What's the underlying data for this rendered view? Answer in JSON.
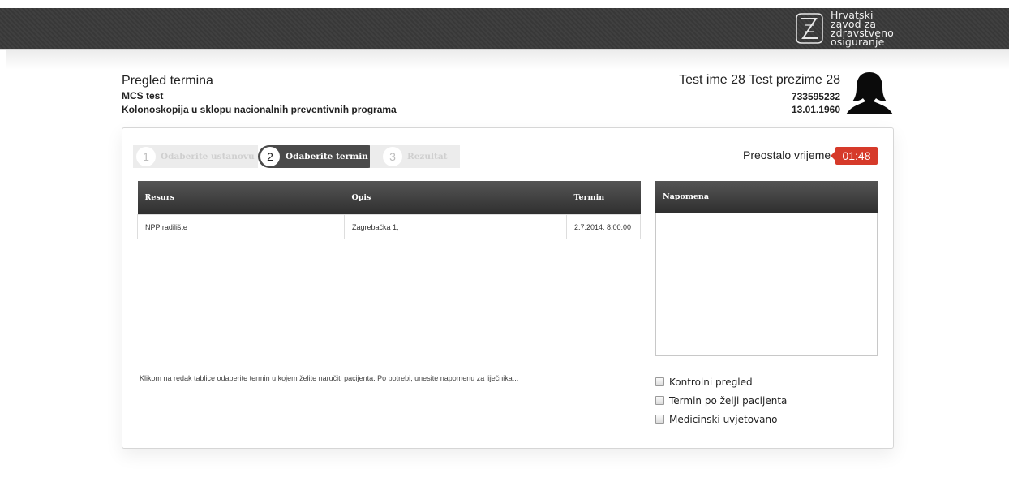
{
  "header": {
    "logo_lines": [
      "Hrvatski",
      "zavod za",
      "zdravstveno",
      "osiguranje"
    ]
  },
  "page": {
    "title": "Pregled termina",
    "subtitle_1": "MCS test",
    "subtitle_2": "Kolonoskopija u sklopu nacionalnih preventivnih programa"
  },
  "patient": {
    "name": "Test ime 28 Test prezime 28",
    "id": "733595232",
    "dob": "13.01.1960"
  },
  "steps": [
    {
      "num": "1",
      "label": "Odaberite ustanovu",
      "state": "inactive"
    },
    {
      "num": "2",
      "label": "Odaberite termin",
      "state": "active"
    },
    {
      "num": "3",
      "label": "Rezultat",
      "state": "inactive"
    }
  ],
  "timer": {
    "label": "Preostalo vrijeme",
    "value": "01:48"
  },
  "table": {
    "headers": [
      "Resurs",
      "Opis",
      "Termin"
    ],
    "rows": [
      [
        "NPP radilište",
        "Zagrebačka 1,",
        "2.7.2014. 8:00:00"
      ]
    ]
  },
  "note": {
    "header": "Napomena",
    "value": ""
  },
  "hint": "Klikom na redak tablice odaberite termin u kojem želite naručiti pacijenta. Po potrebi, unesite napomenu za liječnika...",
  "checkboxes": [
    {
      "label": "Kontrolni pregled",
      "checked": false
    },
    {
      "label": "Termin po želji pacijenta",
      "checked": false
    },
    {
      "label": "Medicinski uvjetovano",
      "checked": false
    }
  ],
  "colors": {
    "topbar": "#3a3a3a",
    "timer": "#d63a2a",
    "active_step": "#4a4a4a"
  }
}
